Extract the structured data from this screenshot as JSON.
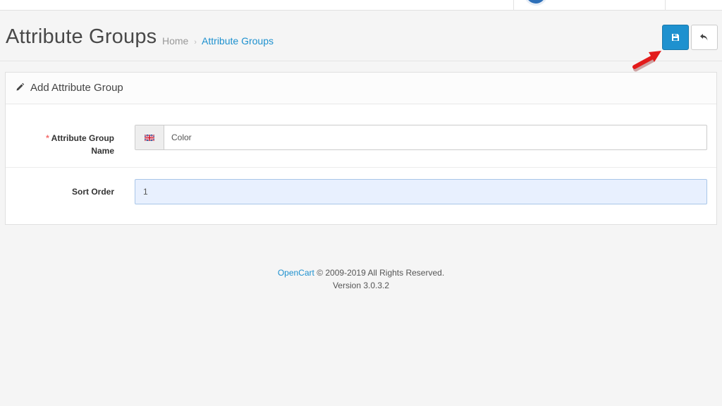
{
  "header": {
    "page_title": "Attribute Groups",
    "breadcrumb": [
      {
        "label": "Home"
      },
      {
        "label": "Attribute Groups"
      }
    ],
    "breadcrumb_separator": "›",
    "save_button_tooltip": "Save",
    "back_button_tooltip": "Cancel"
  },
  "panel": {
    "title": "Add Attribute Group",
    "fields": {
      "name": {
        "required_mark": "*",
        "label_line1": "Attribute Group",
        "label_line2": "Name",
        "value": "Color",
        "language_flag": "uk-flag-icon"
      },
      "sort_order": {
        "label": "Sort Order",
        "value": "1"
      }
    }
  },
  "footer": {
    "brand": "OpenCart",
    "copyright": "© 2009-2019 All Rights Reserved.",
    "version": "Version 3.0.3.2"
  },
  "colors": {
    "primary": "#1e91cf",
    "annotation_arrow": "#e31b1b",
    "required": "#f56b6b"
  }
}
